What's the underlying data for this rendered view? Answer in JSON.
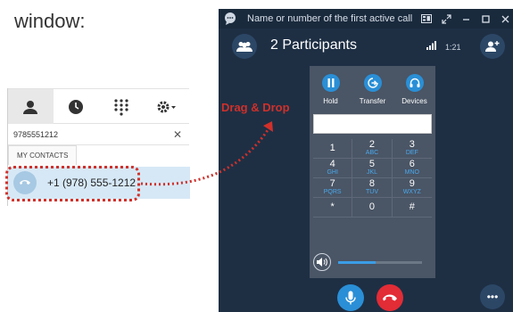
{
  "heading": {
    "line1": "",
    "line2": "window:"
  },
  "contacts": {
    "search_value": "9785551212",
    "clear_glyph": "✕",
    "tab_label": "MY CONTACTS",
    "contact_number": "+1 (978) 555-1212"
  },
  "annotation": {
    "drag_label": "Drag & Drop",
    "color": "#d0302a"
  },
  "call": {
    "title": "Name or number of the first active call",
    "participants": "2 Participants",
    "timer": "1:21",
    "actions": [
      {
        "label": "Hold",
        "icon": "pause-icon"
      },
      {
        "label": "Transfer",
        "icon": "transfer-icon"
      },
      {
        "label": "Devices",
        "icon": "headset-icon"
      }
    ],
    "dial_input_value": "",
    "keys": [
      {
        "digit": "1",
        "letters": ""
      },
      {
        "digit": "2",
        "letters": "ABC"
      },
      {
        "digit": "3",
        "letters": "DEF"
      },
      {
        "digit": "4",
        "letters": "GHI"
      },
      {
        "digit": "5",
        "letters": "JKL"
      },
      {
        "digit": "6",
        "letters": "MNO"
      },
      {
        "digit": "7",
        "letters": "PQRS"
      },
      {
        "digit": "8",
        "letters": "TUV"
      },
      {
        "digit": "9",
        "letters": "WXYZ"
      },
      {
        "digit": "*",
        "letters": ""
      },
      {
        "digit": "0",
        "letters": ""
      },
      {
        "digit": "#",
        "letters": ""
      }
    ],
    "volume_level": 0.45,
    "more_glyph": "•••",
    "colors": {
      "accent": "#2a8fd6",
      "hangup": "#e22c36",
      "background": "#1e2f44"
    }
  }
}
